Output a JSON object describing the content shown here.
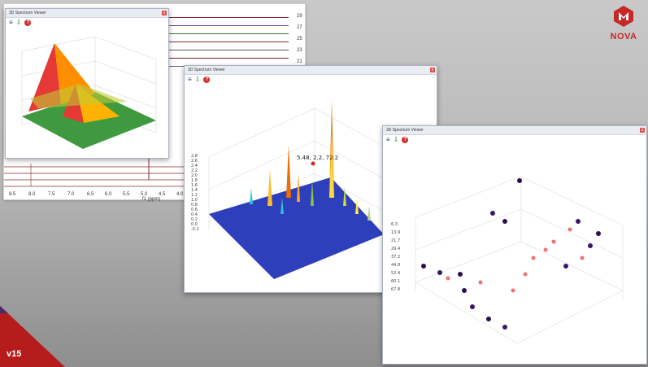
{
  "background_spectrum": {
    "trace_labels": [
      "29",
      "27",
      "25",
      "23",
      "21"
    ],
    "x_ticks": [
      "8.5",
      "8.0",
      "7.5",
      "7.0",
      "6.5",
      "6.0",
      "5.5",
      "5.0",
      "4.5",
      "4.0"
    ],
    "x_label": "f1 (ppm)"
  },
  "window1": {
    "title": "3D Spectrum Viewer",
    "close": "x"
  },
  "window2": {
    "title": "3D Spectrum Viewer",
    "close": "x",
    "annotation": "5.48, 2.2, 72.2",
    "z_ticks": [
      "2.8",
      "2.6",
      "2.4",
      "2.2",
      "2.0",
      "1.8",
      "1.6",
      "1.4",
      "1.2",
      "1.0",
      "0.8",
      "0.6",
      "0.4",
      "0.2",
      "0.0",
      "-0.2"
    ]
  },
  "window3": {
    "title": "3D Spectrum Viewer",
    "close": "x",
    "y_ticks": [
      "6.3",
      "13.9",
      "21.7",
      "29.4",
      "37.2",
      "44.8",
      "52.4",
      "60.1",
      "67.8"
    ]
  },
  "toolbar": {
    "menu_icon": "≡",
    "export_icon": "⇩",
    "help_label": "?"
  },
  "brand": {
    "name": "NOVA",
    "color": "#c62828"
  },
  "version": {
    "label": "v15",
    "badge_color": "#b71c1c"
  }
}
